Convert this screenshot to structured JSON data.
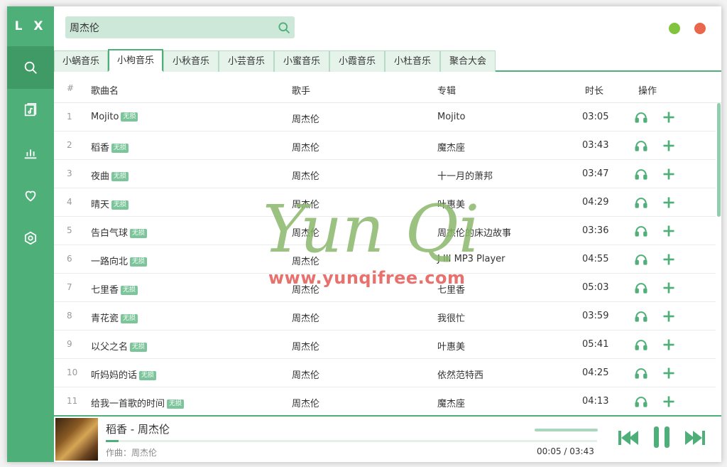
{
  "app": {
    "logo": "L X"
  },
  "sidebar": {
    "items": [
      {
        "name": "search",
        "icon": "search-icon"
      },
      {
        "name": "songlist",
        "icon": "music-list-icon"
      },
      {
        "name": "leaderboard",
        "icon": "bar-chart-icon"
      },
      {
        "name": "favorites",
        "icon": "heart-icon"
      },
      {
        "name": "settings",
        "icon": "settings-icon"
      }
    ]
  },
  "search": {
    "value": "周杰伦",
    "placeholder": ""
  },
  "tabs": [
    {
      "label": "小蜗音乐"
    },
    {
      "label": "小枸音乐"
    },
    {
      "label": "小秋音乐"
    },
    {
      "label": "小芸音乐"
    },
    {
      "label": "小蜜音乐"
    },
    {
      "label": "小霞音乐"
    },
    {
      "label": "小杜音乐"
    },
    {
      "label": "聚合大会"
    }
  ],
  "table": {
    "headers": {
      "num": "#",
      "name": "歌曲名",
      "artist": "歌手",
      "album": "专辑",
      "duration": "时长",
      "actions": "操作"
    },
    "rows": [
      {
        "num": "1",
        "name": "Mojito",
        "badge": "无损",
        "artist": "周杰伦",
        "album": "Mojito",
        "duration": "03:05"
      },
      {
        "num": "2",
        "name": "稻香",
        "badge": "无损",
        "artist": "周杰伦",
        "album": "魔杰座",
        "duration": "03:43"
      },
      {
        "num": "3",
        "name": "夜曲",
        "badge": "无损",
        "artist": "周杰伦",
        "album": "十一月的萧邦",
        "duration": "03:47"
      },
      {
        "num": "4",
        "name": "晴天",
        "badge": "无损",
        "artist": "周杰伦",
        "album": "叶惠美",
        "duration": "04:29"
      },
      {
        "num": "5",
        "name": "告白气球",
        "badge": "无损",
        "artist": "周杰伦",
        "album": "周杰伦的床边故事",
        "duration": "03:36"
      },
      {
        "num": "6",
        "name": "一路向北",
        "badge": "无损",
        "artist": "周杰伦",
        "album": "J III MP3 Player",
        "duration": "04:55"
      },
      {
        "num": "7",
        "name": "七里香",
        "badge": "无损",
        "artist": "周杰伦",
        "album": "七里香",
        "duration": "05:03"
      },
      {
        "num": "8",
        "name": "青花瓷",
        "badge": "无损",
        "artist": "周杰伦",
        "album": "我很忙",
        "duration": "03:59"
      },
      {
        "num": "9",
        "name": "以父之名",
        "badge": "无损",
        "artist": "周杰伦",
        "album": "叶惠美",
        "duration": "05:41"
      },
      {
        "num": "10",
        "name": "听妈妈的话",
        "badge": "无损",
        "artist": "周杰伦",
        "album": "依然范特西",
        "duration": "04:25"
      },
      {
        "num": "11",
        "name": "给我一首歌的时间",
        "badge": "无损",
        "artist": "周杰伦",
        "album": "魔杰座",
        "duration": "04:13"
      }
    ]
  },
  "player": {
    "title": "稻香 - 周杰伦",
    "lyric": "作曲：周杰伦",
    "time": "00:05 / 03:43",
    "progress_fraction": 0.02
  },
  "watermark": {
    "text": "Yun Qi",
    "url": "www.yunqifree.com"
  },
  "colors": {
    "accent": "#4faf79",
    "accent_dark": "#3f9a66",
    "min": "#82c440",
    "close": "#e9674d"
  }
}
